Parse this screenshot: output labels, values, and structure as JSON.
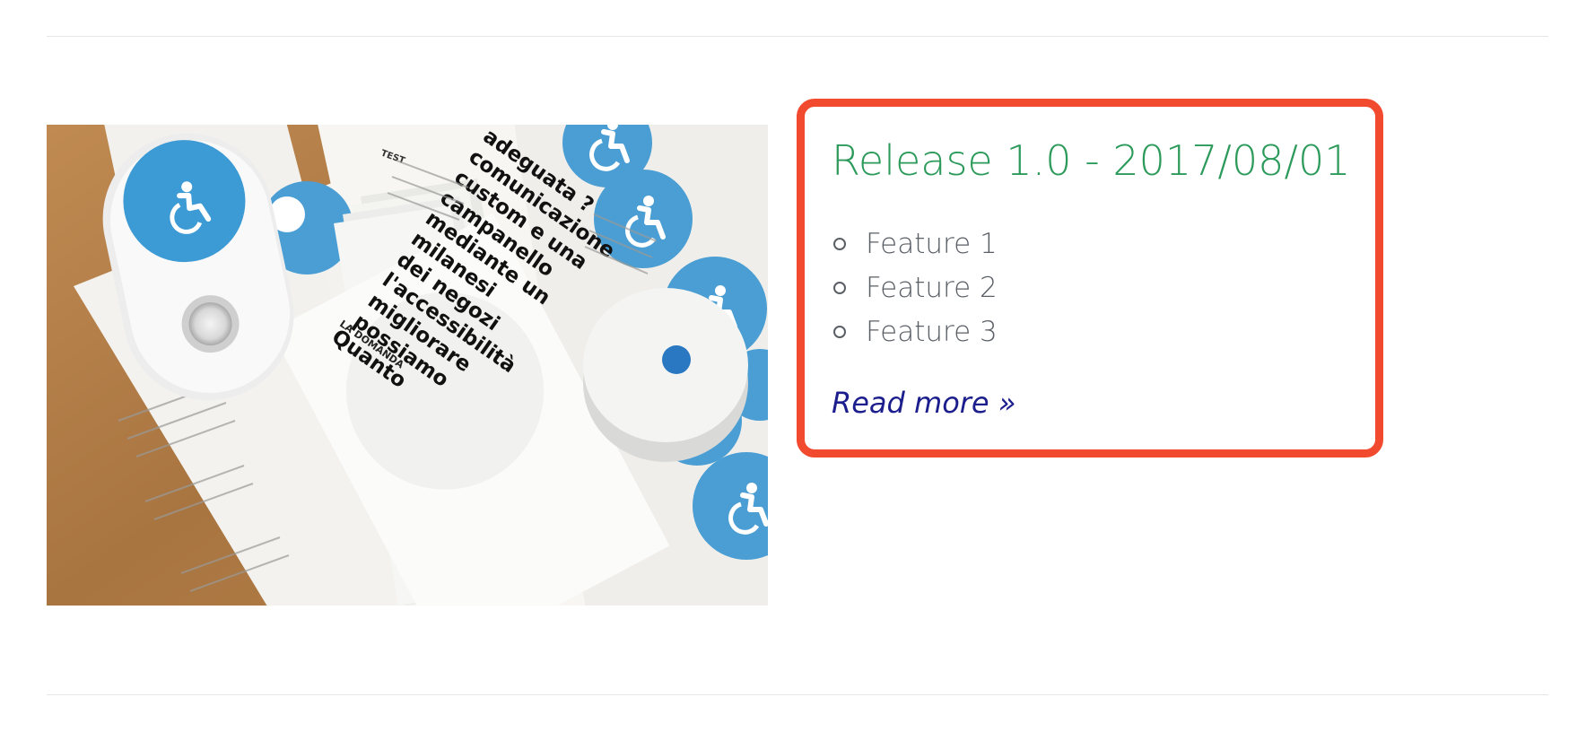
{
  "release": {
    "title": "Release 1.0 - 2017/08/01",
    "features": [
      "Feature 1",
      "Feature 2",
      "Feature 3"
    ],
    "read_more": "Read more »"
  },
  "colors": {
    "title": "#2c9a5a",
    "card_border": "#f24a2e",
    "link": "#1b1e8c",
    "body_text": "#5a5f66"
  },
  "image": {
    "flyer_heading": "LA DOMANDA",
    "flyer_text": [
      "Quanto",
      "possiamo",
      "migliorare",
      "l'accessibilità",
      "dei negozi",
      "milanesi",
      "mediante un",
      "campanello",
      "custom e una",
      "comunicazione",
      "adeguata ?"
    ],
    "doc_label": "TEST"
  }
}
